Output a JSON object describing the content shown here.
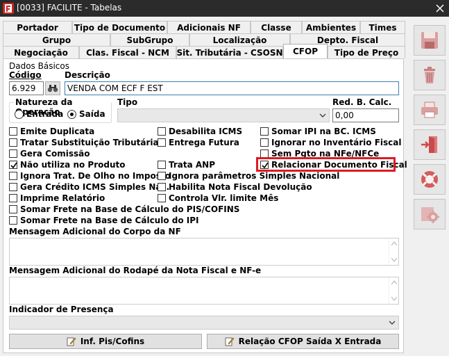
{
  "window": {
    "title": "[0033] FACILITE - Tabelas"
  },
  "tabs": {
    "row1": [
      "Portador",
      "Tipo de Documento",
      "Adicionais NF",
      "Classe",
      "Ambientes",
      "Times"
    ],
    "row2": [
      "Grupo",
      "SubGrupo",
      "Localização",
      "Depto. Fiscal"
    ],
    "row3": [
      "Negociação",
      "Clas. Fiscal - NCM",
      "Sit. Tributária - CSOSN",
      "CFOP",
      "Tipo de Preço"
    ],
    "active": "CFOP"
  },
  "dados_basicos": {
    "legend": "Dados Básicos",
    "codigo_label": "Código",
    "codigo_value": "6.929",
    "descricao_label": "Descrição",
    "descricao_value": "VENDA COM ECF F EST",
    "natureza_legend": "Natureza da Operação",
    "entrada_label": "Entrada",
    "saida_label": "Saída",
    "natureza_selected": "Saída",
    "tipo_label": "Tipo",
    "tipo_value": "",
    "red_label": "Red. B. Calc.",
    "red_value": "0,00"
  },
  "checkboxes": {
    "emite_duplicata": {
      "label": "Emite Duplicata",
      "checked": false
    },
    "desabilita_icms": {
      "label": "Desabilita ICMS",
      "checked": false
    },
    "somar_ipi": {
      "label": "Somar IPI na BC. ICMS",
      "checked": false
    },
    "tratar_st": {
      "label": "Tratar Substituição Tributária",
      "checked": false
    },
    "entrega_futura": {
      "label": "Entrega Futura",
      "checked": false
    },
    "ignorar_inventario": {
      "label": "Ignorar no Inventário Fiscal",
      "checked": false
    },
    "gera_comissao": {
      "label": "Gera Comissão",
      "checked": false
    },
    "sem_pgto": {
      "label": "Sem Pgto na NFe/NFCe",
      "checked": false
    },
    "nao_utiliza_produto": {
      "label": "Não utiliza no Produto",
      "checked": true
    },
    "trata_anp": {
      "label": "Trata ANP",
      "checked": false
    },
    "relacionar_doc": {
      "label": "Relacionar Documento Fiscal",
      "checked": true
    },
    "ignora_olho": {
      "label": "Ignora Trat. De Olho no Imposto",
      "checked": false
    },
    "ignora_simples": {
      "label": "Ignora parâmetros Simples Nacional",
      "checked": false
    },
    "gera_credito": {
      "label": "Gera Crédito ICMS Simples Nac.",
      "checked": false
    },
    "habilita_devolucao": {
      "label": "Habilita Nota Fiscal Devolução",
      "checked": false
    },
    "imprime_relatorio": {
      "label": "Imprime Relatório",
      "checked": false
    },
    "controla_limite": {
      "label": "Controla Vlr. limite Mês",
      "checked": false
    },
    "somar_frete_pis": {
      "label": "Somar Frete na Base de Cálculo do PIS/COFINS",
      "checked": false
    },
    "somar_frete_ipi": {
      "label": "Somar Frete na Base de Cálculo do IPI",
      "checked": false
    }
  },
  "mensagens": {
    "corpo_label": "Mensagem Adicional do Corpo da NF",
    "rodape_label": "Mensagem Adicional do Rodapé da Nota Fiscal e NF-e",
    "indicador_label": "Indicador de Presença"
  },
  "buttons": {
    "inf_pis": "Inf. Pis/Cofins",
    "relacao_cfop": "Relação CFOP Saída X Entrada"
  },
  "sidebar_icons": [
    "save-icon",
    "delete-icon",
    "print-icon",
    "exit-icon",
    "help-icon",
    "settings-icon"
  ],
  "colors": {
    "titlebar": "#2b2b2b",
    "highlight": "#e01a22",
    "focus_border": "#3c7fb1"
  }
}
